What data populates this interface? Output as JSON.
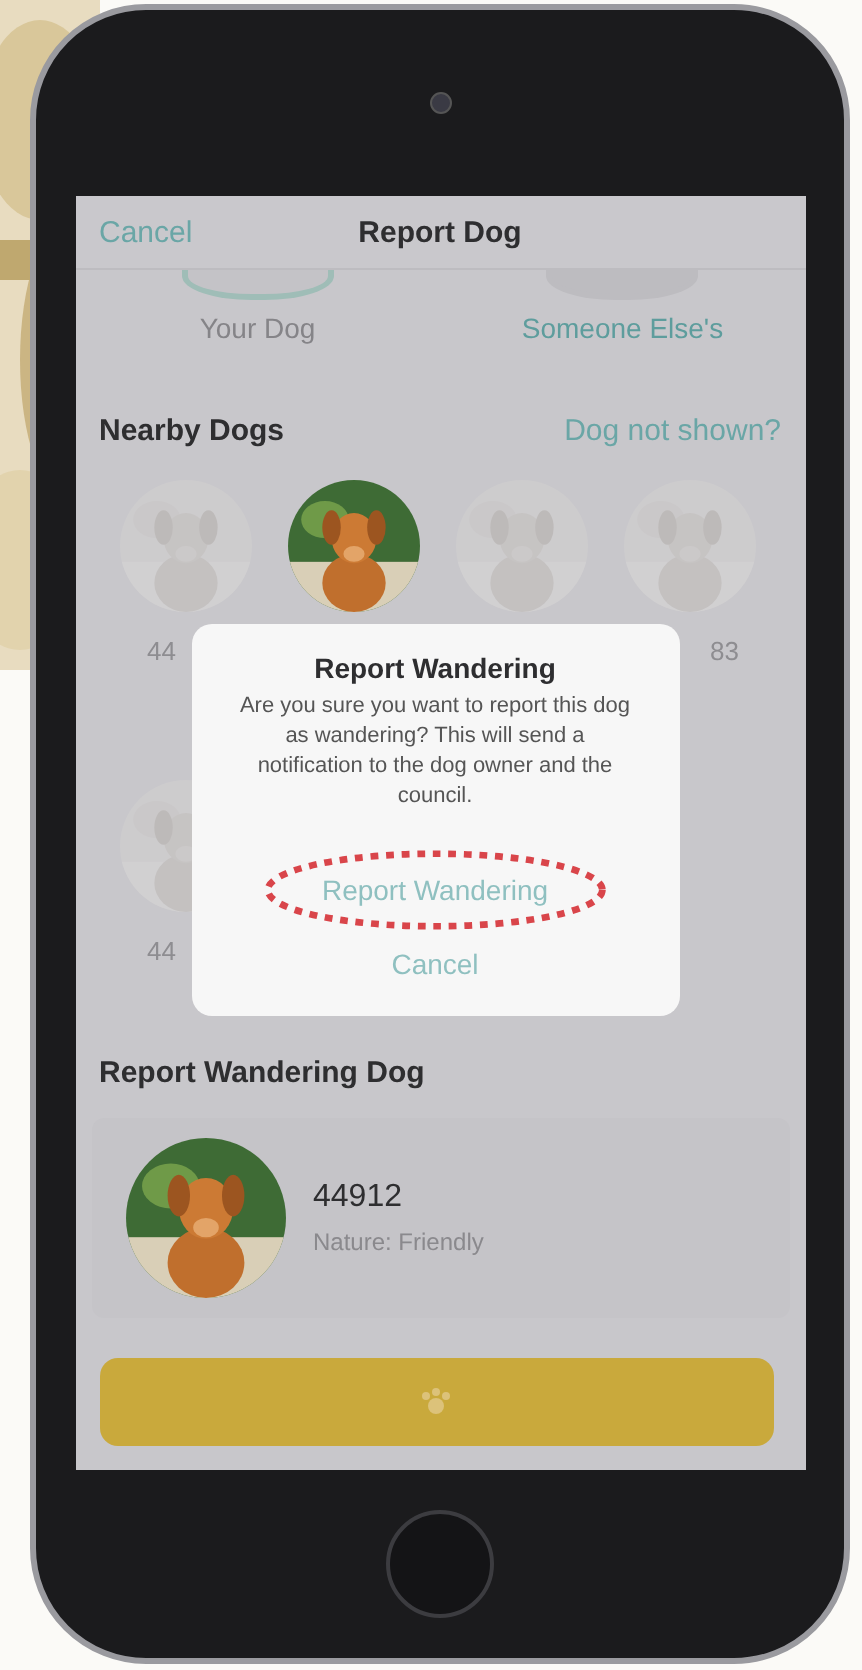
{
  "nav": {
    "cancel": "Cancel",
    "title": "Report Dog"
  },
  "owner_options": [
    {
      "label": "Your Dog",
      "selected": false
    },
    {
      "label": "Someone Else's",
      "selected": true
    }
  ],
  "nearby": {
    "title": "Nearby Dogs",
    "link": "Dog not shown?",
    "dogs": [
      {
        "label": "44",
        "selected": false
      },
      {
        "selected": true
      },
      {
        "selected": false
      },
      {
        "label": "83",
        "selected": false
      },
      {
        "label": "44",
        "selected": false
      }
    ]
  },
  "dialog": {
    "title": "Report Wandering",
    "message": "Are you sure you want to report this dog as wandering? This will send a notification to the dog owner and the council.",
    "buttons": [
      {
        "label": "Report Wandering",
        "highlighted": true
      },
      {
        "label": "Cancel",
        "highlighted": false
      }
    ]
  },
  "report": {
    "title": "Report Wandering Dog",
    "dog": {
      "id": "44912",
      "nature": "Nature: Friendly"
    }
  }
}
